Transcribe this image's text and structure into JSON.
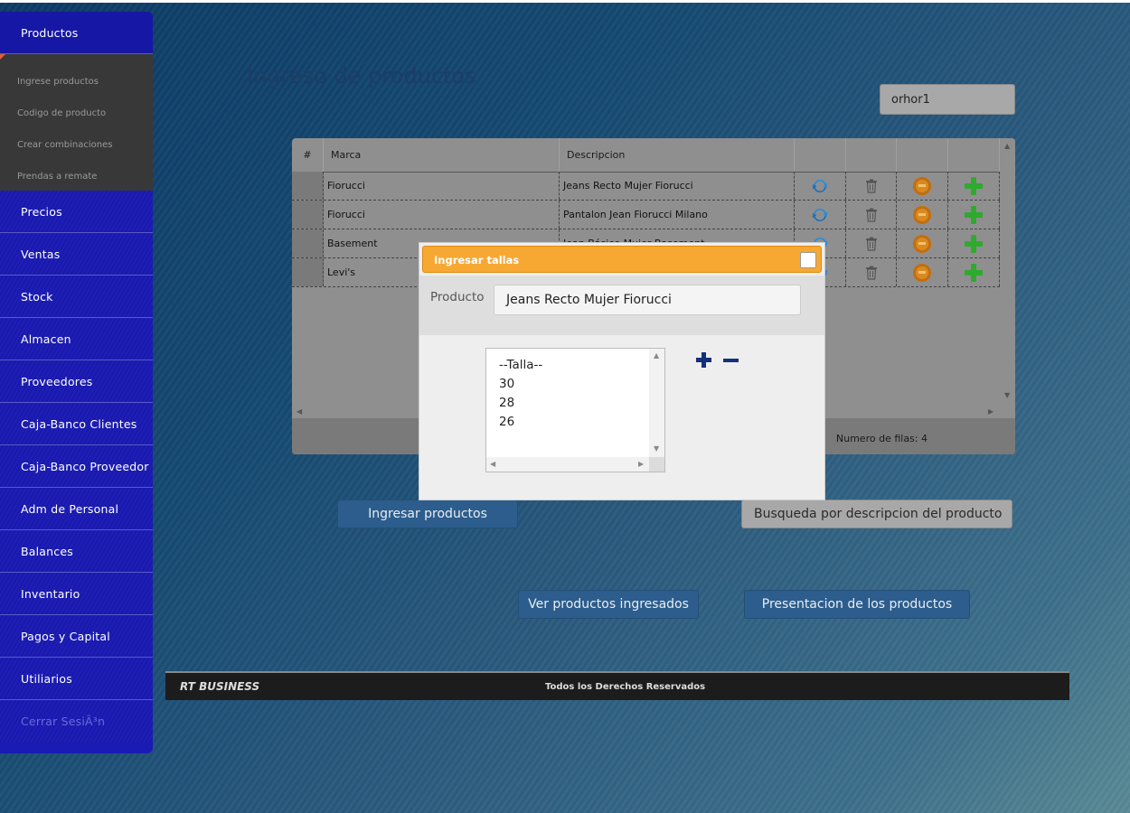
{
  "sidebar": {
    "productos": "Productos",
    "submenu": [
      "Ingrese productos",
      "Codigo de producto",
      "Crear combinaciones",
      "Prendas a remate"
    ],
    "items": [
      "Precios",
      "Ventas",
      "Stock",
      "Almacen",
      "Proveedores",
      "Caja-Banco Clientes",
      "Caja-Banco Proveedor",
      "Adm de Personal",
      "Balances",
      "Inventario",
      "Pagos y Capital",
      "Utiliarios"
    ],
    "logout": "Cerrar SesiÃ³n"
  },
  "page": {
    "title": "Ingreso de productos",
    "search_value": "orhor1"
  },
  "grid": {
    "headers": [
      "#",
      "Marca",
      "Descripcion",
      "",
      "",
      "",
      ""
    ],
    "rows": [
      {
        "marca": "Fiorucci",
        "descripcion": "Jeans Recto Mujer Fiorucci"
      },
      {
        "marca": "Fiorucci",
        "descripcion": "Pantalon Jean Fiorucci Milano"
      },
      {
        "marca": "Basement",
        "descripcion": "Jean Básico Mujer Basement"
      },
      {
        "marca": "Levi's",
        "descripcion": ""
      }
    ],
    "row_count": "Numero de filas: 4"
  },
  "buttons": {
    "ingresar": "Ingresar productos",
    "busqueda_placeholder": "Busqueda por descripcion del producto",
    "ver": "Ver productos ingresados",
    "presentacion": "Presentacion de los productos"
  },
  "footer": {
    "brand": "RT BUSINESS",
    "rights": "Todos los Derechos Reservados"
  },
  "dialog": {
    "title": "Ingresar tallas",
    "producto_label": "Producto",
    "producto_value": "Jeans Recto Mujer Fiorucci",
    "tallas": [
      "--Talla--",
      "30",
      "28",
      "26"
    ]
  },
  "colors": {
    "sidebar": "#1a1ab4",
    "dialog_title": "#f7a832",
    "accent_dark_blue": "#14307a"
  },
  "icons": [
    "refresh-icon",
    "trash-icon",
    "disc-icon",
    "plus-icon",
    "close-icon"
  ]
}
